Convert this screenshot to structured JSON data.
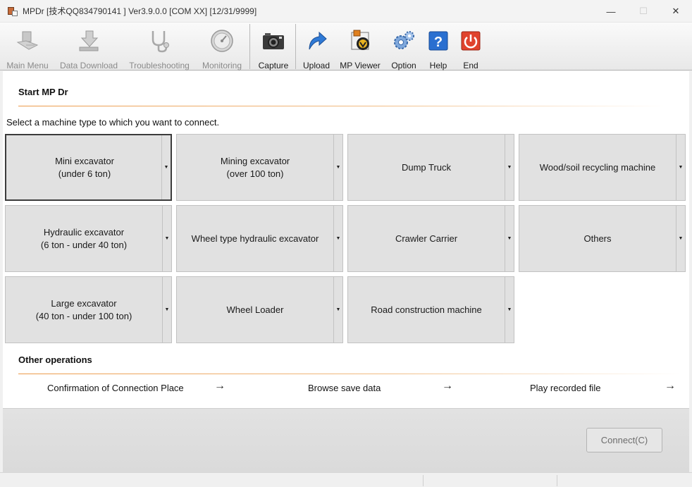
{
  "window": {
    "title": "MPDr [技术QQ834790141 ] Ver3.9.0.0 [COM XX] [12/31/9999]",
    "controls": {
      "minimize": "—",
      "maximize": "☐",
      "close": "✕"
    }
  },
  "toolbar": {
    "items": [
      {
        "label": "Main Menu",
        "icon": "main-menu-icon",
        "enabled": false
      },
      {
        "label": "Data Download",
        "icon": "download-icon",
        "enabled": false
      },
      {
        "label": "Troubleshooting",
        "icon": "stethoscope-icon",
        "enabled": false
      },
      {
        "label": "Monitoring",
        "icon": "gauge-icon",
        "enabled": false
      },
      {
        "label": "Capture",
        "icon": "camera-icon",
        "enabled": true
      },
      {
        "label": "Upload",
        "icon": "upload-icon",
        "enabled": true
      },
      {
        "label": "MP Viewer",
        "icon": "mp-viewer-icon",
        "enabled": true
      },
      {
        "label": "Option",
        "icon": "gears-icon",
        "enabled": true
      },
      {
        "label": "Help",
        "icon": "help-icon",
        "enabled": true
      },
      {
        "label": "End",
        "icon": "power-icon",
        "enabled": true
      }
    ]
  },
  "start": {
    "title": "Start MP Dr",
    "instruction": "Select a machine type to which you want to connect."
  },
  "machines": [
    {
      "label": "Mini excavator\n(under 6 ton)",
      "selected": true
    },
    {
      "label": "Mining excavator\n(over 100 ton)",
      "selected": false
    },
    {
      "label": "Dump Truck",
      "selected": false
    },
    {
      "label": "Wood/soil recycling machine",
      "selected": false
    },
    {
      "label": "Hydraulic excavator\n(6 ton - under 40 ton)",
      "selected": false
    },
    {
      "label": "Wheel type hydraulic excavator",
      "selected": false
    },
    {
      "label": "Crawler Carrier",
      "selected": false
    },
    {
      "label": "Others",
      "selected": false
    },
    {
      "label": "Large excavator\n(40 ton - under 100 ton)",
      "selected": false
    },
    {
      "label": "Wheel Loader",
      "selected": false
    },
    {
      "label": "Road construction machine",
      "selected": false
    }
  ],
  "dropdown_glyph": "▼",
  "other_ops": {
    "title": "Other operations",
    "links": [
      {
        "label": "Confirmation of Connection Place",
        "arrow": "→"
      },
      {
        "label": "Browse save data",
        "arrow": "→"
      },
      {
        "label": "Play recorded file",
        "arrow": "→"
      }
    ]
  },
  "footer": {
    "connect_label": "Connect(C)",
    "connect_enabled": false
  },
  "colors": {
    "accent_line": "#ec9a49",
    "button_face": "#e1e1e1",
    "selected_border": "#3c3c3c"
  }
}
